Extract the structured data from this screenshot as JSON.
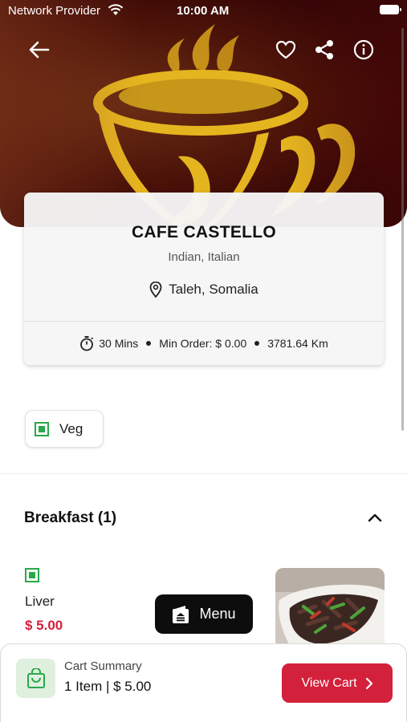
{
  "status_bar": {
    "carrier": "Network Provider",
    "time": "10:00 AM"
  },
  "restaurant": {
    "name": "CAFE CASTELLO",
    "cuisine": "Indian, Italian",
    "location": "Taleh, Somalia",
    "delivery_time": "30 Mins",
    "min_order": "Min Order: $ 0.00",
    "distance": "3781.64 Km"
  },
  "filters": {
    "veg_label": "Veg"
  },
  "category": {
    "title": "Breakfast (1)"
  },
  "items": [
    {
      "name": "Liver",
      "price": "$ 5.00"
    }
  ],
  "menu_button": {
    "label": "Menu"
  },
  "cart": {
    "title": "Cart Summary",
    "summary": "1 Item | $ 5.00",
    "button_label": "View Cart"
  },
  "colors": {
    "accent": "#d3203b",
    "veg": "#2aa84a",
    "dark": "#0d0d0d"
  }
}
